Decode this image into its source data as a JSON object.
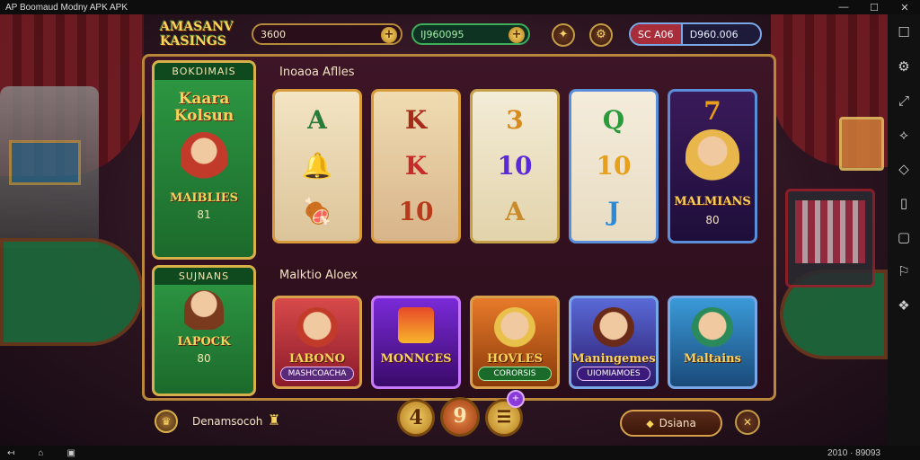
{
  "window": {
    "title": "AP Boomaud Modny APK APK",
    "controls": [
      "—",
      "☐",
      "✕"
    ]
  },
  "header": {
    "logo": "AMASANV KASINGS",
    "coins_value": "3600",
    "gems_value": "IJ960095",
    "status_tag": "SC A06",
    "status_value": "D960.006"
  },
  "promos": [
    {
      "head": "BOKDIMAIS",
      "title": "Kaara Kolsun",
      "sub": "MAIBLIES",
      "num": "81"
    },
    {
      "head": "SUJNANS",
      "title": "",
      "sub": "IAPOCK",
      "num": "80"
    }
  ],
  "sections": {
    "featured_title": "Inoaoa Aflles",
    "more_title": "Malktio Aloex"
  },
  "cards": [
    {
      "symbols": [
        "A",
        "🔔",
        "🍖"
      ],
      "colors": [
        "#2a7a3a",
        "#c48a1a",
        "#8a4a1a"
      ]
    },
    {
      "symbols": [
        "K",
        "K",
        "10"
      ],
      "colors": [
        "#a82a1a",
        "#c82a2a",
        "#b83a1a"
      ]
    },
    {
      "symbols": [
        "3",
        "10",
        "A"
      ],
      "colors": [
        "#d88a1a",
        "#5a2ad8",
        "#c88a2a"
      ]
    },
    {
      "symbols": [
        "Q",
        "10",
        "J"
      ],
      "colors": [
        "#2a9a3a",
        "#e8a01a",
        "#2a8ad8"
      ]
    },
    {
      "symbols": [
        "7"
      ],
      "title": "MALMIANS",
      "num": "80",
      "colors": [
        "#e8a01a"
      ]
    }
  ],
  "games": [
    {
      "title": "IABONO",
      "sub": "MASHCOACHA"
    },
    {
      "title": "MONNCES",
      "sub": ""
    },
    {
      "title": "HOVLES",
      "sub": "CORORSIS"
    },
    {
      "title": "Maningemes",
      "sub": "UIOMIAMOES"
    },
    {
      "title": "Maltains",
      "sub": ""
    }
  ],
  "footer": {
    "label": "Denamsocoh",
    "btn1": "4",
    "btn2": "9",
    "btn3": "☰",
    "badge": "+",
    "cta_label": "Dsiana",
    "cta_icon": "◆"
  },
  "bottombar": {
    "status": "2010  ·  89093"
  },
  "accent": "#d8a04a"
}
